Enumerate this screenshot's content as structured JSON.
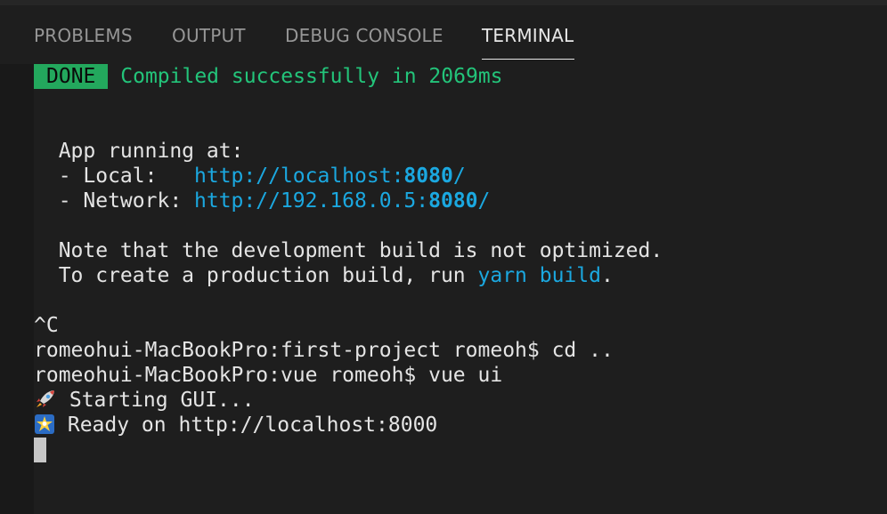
{
  "tabs": [
    {
      "label": "PROBLEMS",
      "active": false
    },
    {
      "label": "OUTPUT",
      "active": false
    },
    {
      "label": "DEBUG CONSOLE",
      "active": false
    },
    {
      "label": "TERMINAL",
      "active": true
    }
  ],
  "terminal": {
    "done_badge": "DONE",
    "compiled_message": "Compiled successfully in 2069ms",
    "app_running": "  App running at:",
    "local_label": "  - Local:   ",
    "local_url_prefix": "http://localhost:",
    "local_url_port": "8080",
    "local_url_suffix": "/",
    "network_label": "  - Network: ",
    "network_url_prefix": "http://192.168.0.5:",
    "network_url_port": "8080",
    "network_url_suffix": "/",
    "note_line": "  Note that the development build is not optimized.",
    "production_prefix": "  To create a production build, run ",
    "production_cmd": "yarn build",
    "production_suffix": ".",
    "ctrl_c": "^C",
    "prompt_1": "romeohui-MacBookPro:first-project romeoh$ cd ..",
    "prompt_2": "romeohui-MacBookPro:vue romeoh$ vue ui",
    "starting_gui": " Starting GUI...",
    "ready_on": " Ready on http://localhost:8000"
  },
  "colors": {
    "background": "#1e1e1e",
    "success_green": "#23c47a",
    "badge_green": "#23a85d",
    "link_blue": "#1ba8e0",
    "text": "#e4e4e4"
  },
  "icons": {
    "starting": "rocket-icon",
    "ready": "star-burst-icon"
  }
}
